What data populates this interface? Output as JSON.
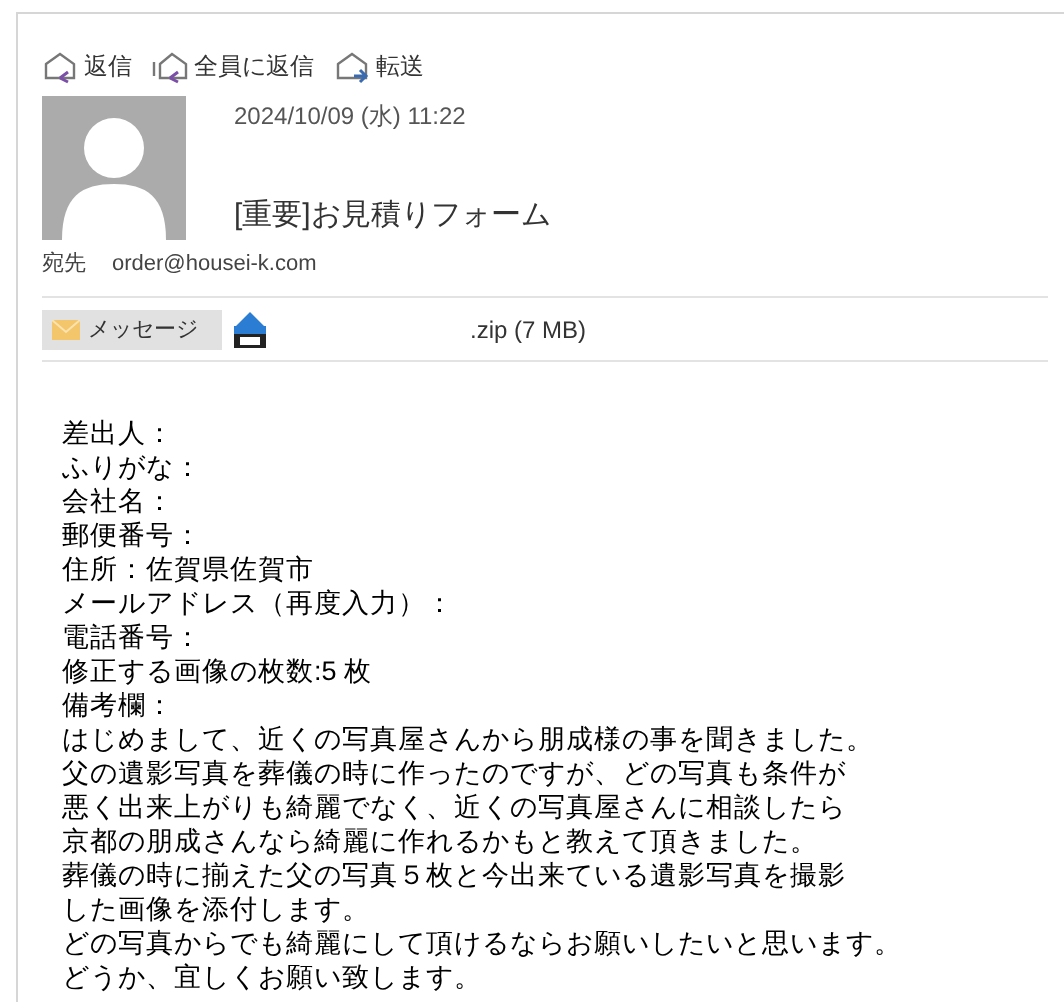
{
  "toolbar": [
    {
      "kind": "reply",
      "label": "返信"
    },
    {
      "kind": "reply_all",
      "label": "全員に返信"
    },
    {
      "kind": "forward",
      "label": "転送"
    }
  ],
  "message": {
    "date": "2024/10/09 (水) 11:22",
    "subject": "[重要]お見積りフォーム",
    "to_label": "宛先",
    "to": "order@housei-k.com"
  },
  "attachments": [
    {
      "kind": "message",
      "label": "メッセージ",
      "selected": true
    },
    {
      "kind": "zip",
      "label": ".zip (7 MB)",
      "selected": false
    }
  ],
  "body_lines": [
    "差出人：",
    "ふりがな：",
    "会社名：",
    "郵便番号：",
    "住所：佐賀県佐賀市",
    "メールアドレス（再度入力）：",
    "電話番号：",
    "修正する画像の枚数:5 枚",
    "備考欄：",
    "はじめまして、近くの写真屋さんから朋成様の事を聞きました。",
    "父の遺影写真を葬儀の時に作ったのですが、どの写真も条件が",
    "悪く出来上がりも綺麗でなく、近くの写真屋さんに相談したら",
    "京都の朋成さんなら綺麗に作れるかもと教えて頂きました。",
    "葬儀の時に揃えた父の写真５枚と今出来ている遺影写真を撮影",
    "した画像を添付します。",
    "どの写真からでも綺麗にして頂けるならお願いしたいと思います。",
    "どうか、宜しくお願い致します。"
  ]
}
